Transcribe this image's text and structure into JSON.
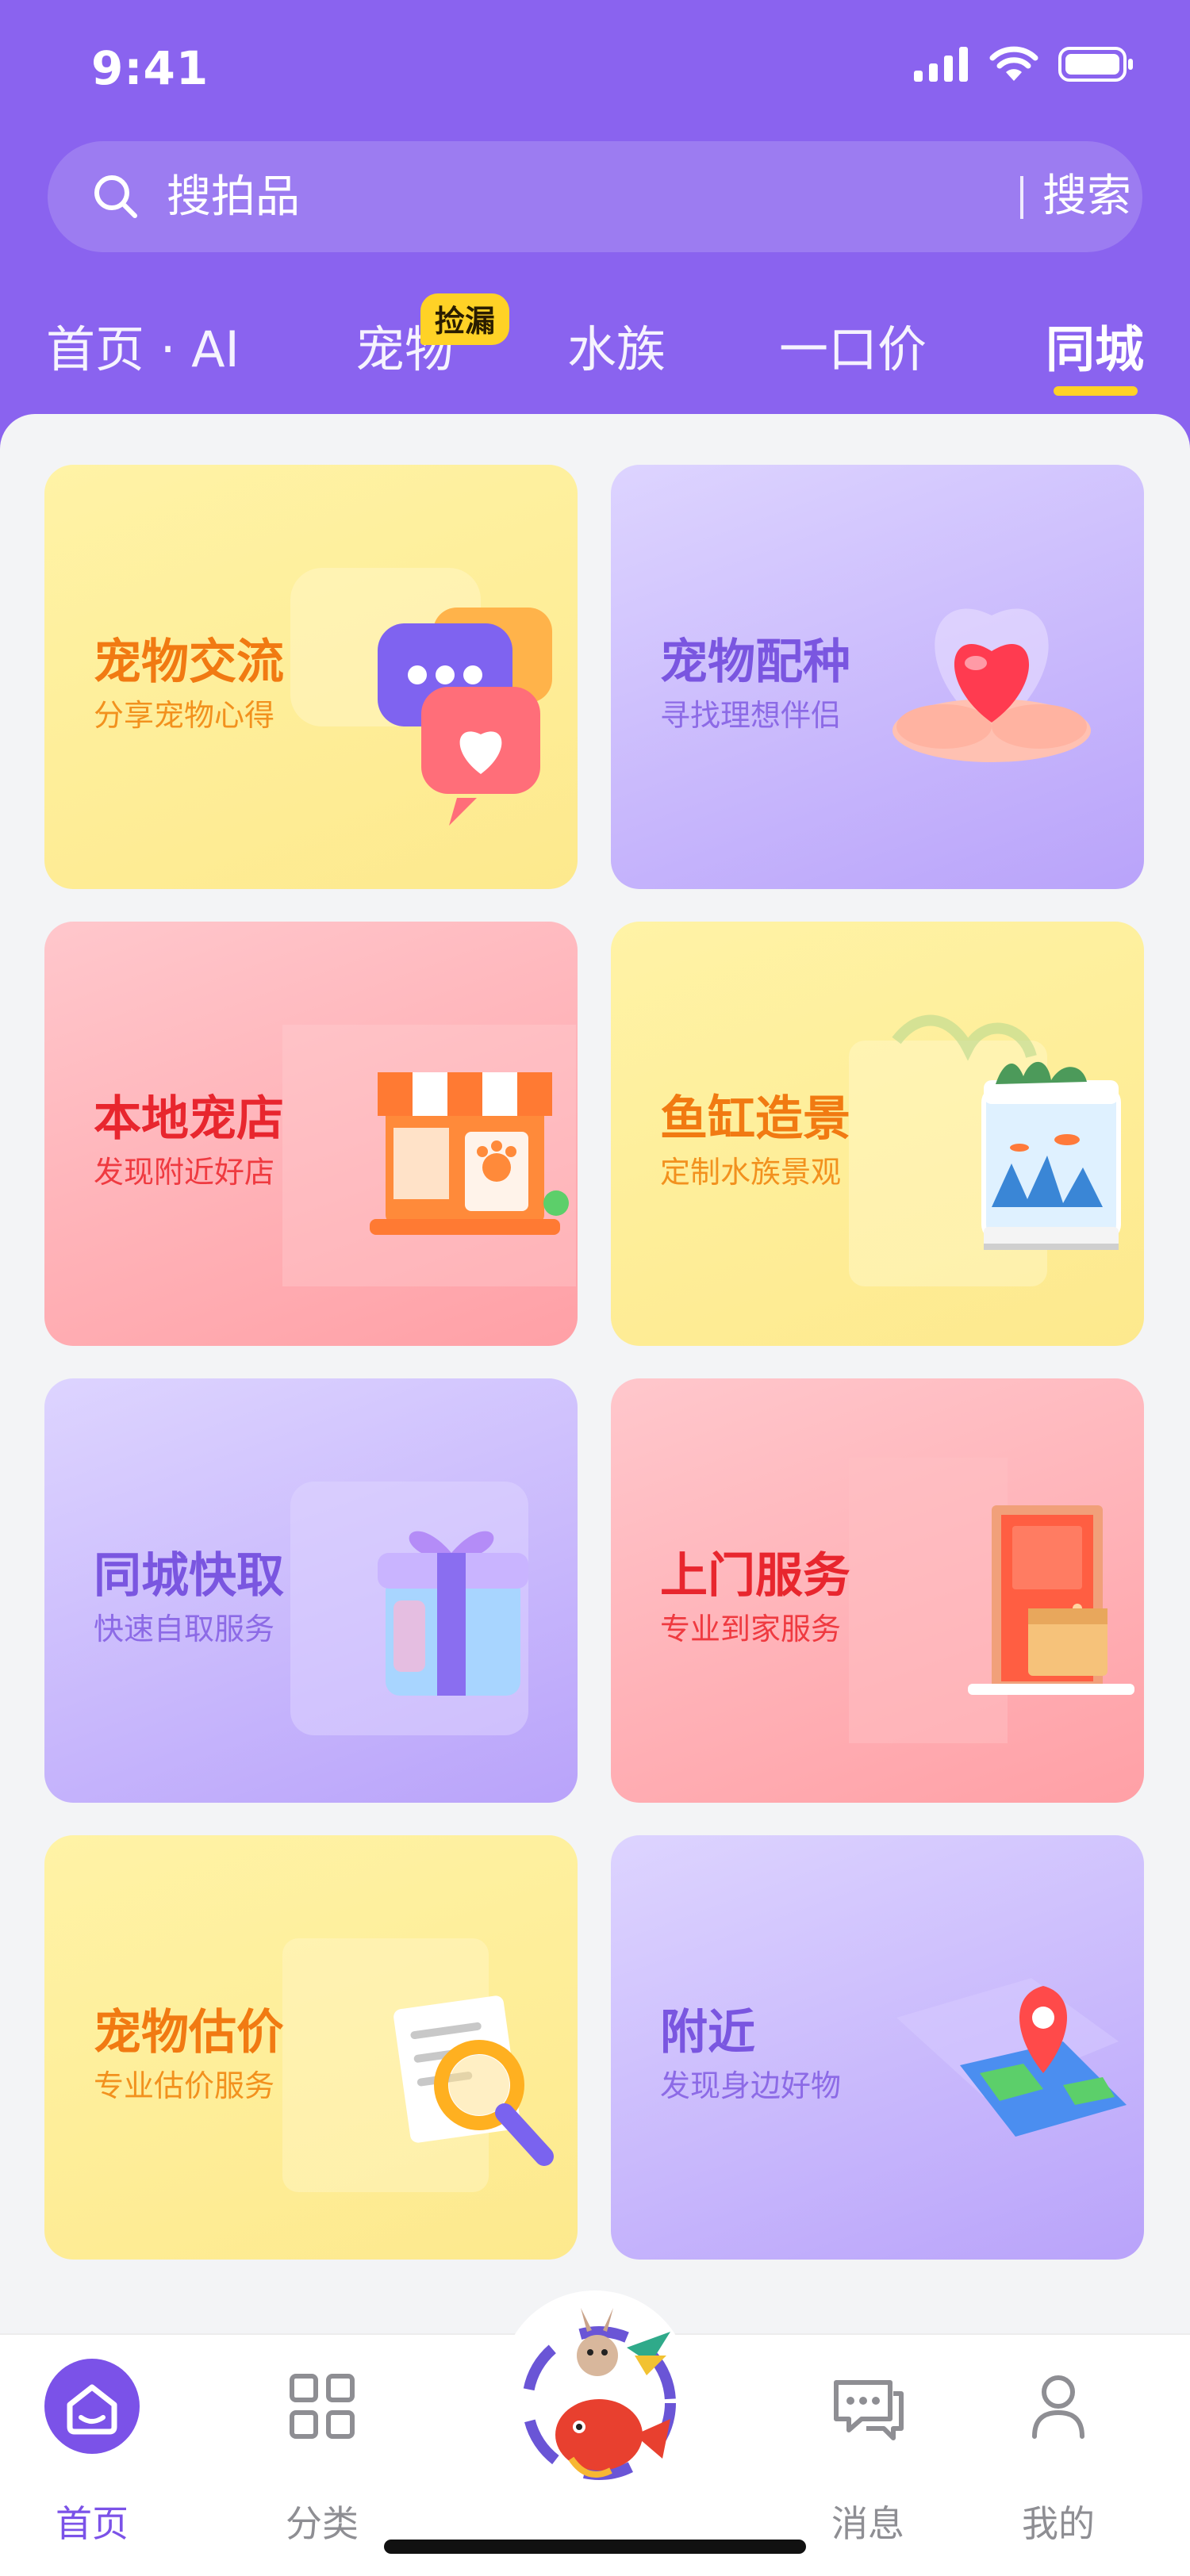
{
  "status_bar": {
    "time": "9:41"
  },
  "search": {
    "placeholder": "搜拍品",
    "button_label": "搜索"
  },
  "tabs": [
    {
      "label": "首页 · AI"
    },
    {
      "label": "宠物",
      "badge": "捡漏"
    },
    {
      "label": "水族"
    },
    {
      "label": "一口价"
    },
    {
      "label": "同城",
      "active": true
    }
  ],
  "cards": [
    {
      "title": "宠物交流",
      "subtitle": "分享宠物心得",
      "icon": "chat-bubbles-icon",
      "theme": "yellow"
    },
    {
      "title": "宠物配种",
      "subtitle": "寻找理想伴侣",
      "icon": "heart-hands-icon",
      "theme": "purple"
    },
    {
      "title": "本地宠店",
      "subtitle": "发现附近好店",
      "icon": "pet-store-icon",
      "theme": "pink"
    },
    {
      "title": "鱼缸造景",
      "subtitle": "定制水族景观",
      "icon": "aquarium-icon",
      "theme": "yellow"
    },
    {
      "title": "同城快取",
      "subtitle": "快速自取服务",
      "icon": "gift-box-icon",
      "theme": "purple"
    },
    {
      "title": "上门服务",
      "subtitle": "专业到家服务",
      "icon": "door-package-icon",
      "theme": "pink"
    },
    {
      "title": "宠物估价",
      "subtitle": "专业估价服务",
      "icon": "appraisal-magnifier-icon",
      "theme": "yellow"
    },
    {
      "title": "附近",
      "subtitle": "发现身边好物",
      "icon": "map-pin-icon",
      "theme": "purple"
    }
  ],
  "bottom_nav": [
    {
      "label": "首页",
      "icon": "home-icon",
      "active": true
    },
    {
      "label": "分类",
      "icon": "grid-icon"
    },
    {
      "label": "",
      "icon": "mascot-logo-icon"
    },
    {
      "label": "消息",
      "icon": "message-icon"
    },
    {
      "label": "我的",
      "icon": "profile-icon"
    }
  ],
  "colors": {
    "header": "#8a63ef",
    "accent_yellow": "#ffd226",
    "active_nav": "#7b52e8"
  }
}
